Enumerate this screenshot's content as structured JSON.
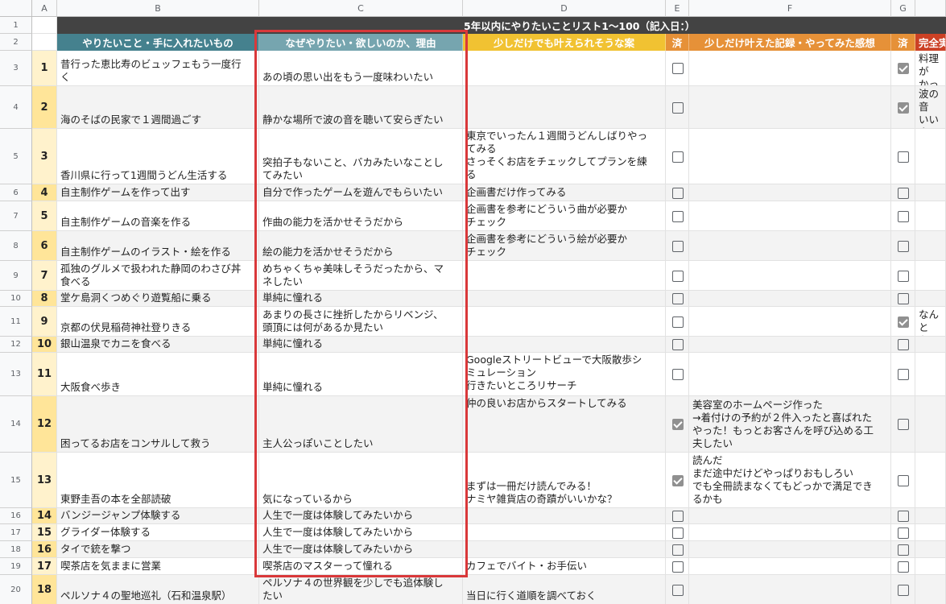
{
  "columns": [
    "A",
    "B",
    "C",
    "D",
    "E",
    "F",
    "G"
  ],
  "sheet_title": "5年以内にやりたいことリスト1〜100（記入日：）",
  "headers": {
    "b": "やりたいこと・手に入れたいもの",
    "c": "なぜやりたい・欲しいのか、理由",
    "d": "少しだけでも叶えられそうな案",
    "e": "済",
    "f": "少しだけ叶えた記録・やってみた感想",
    "g": "済",
    "h": "完全実"
  },
  "colors": {
    "header_b": "#45818e",
    "header_c": "#76a5af",
    "header_d": "#f1c232",
    "header_e": "#e69138",
    "header_f": "#e69138",
    "header_g": "#e69138",
    "header_h": "#cc4125",
    "num_bg": "#ffe599",
    "num_bg_alt": "#fff2cc",
    "title_bg": "#434343",
    "highlight": "#d9383a"
  },
  "rows": [
    {
      "rn": "1"
    },
    {
      "rn": "2"
    },
    {
      "rn": "3",
      "num": "1",
      "b": "昔行った恵比寿のビュッフェもう一度行\nく",
      "c": "あの頃の思い出をもう一度味わいたい",
      "d": "",
      "e": false,
      "f": "",
      "g": true,
      "h": "料理が\nかった"
    },
    {
      "rn": "4",
      "num": "2",
      "b": "海のそばの民家で１週間過ごす",
      "c": "静かな場所で波の音を聴いて安らぎたい",
      "d": "",
      "e": false,
      "f": "",
      "g": true,
      "h": "波の音\nいい人\nらった"
    },
    {
      "rn": "5",
      "num": "3",
      "b": "香川県に行って1週間うどん生活する",
      "c": "突拍子もないこと、バカみたいなことし\nてみたい",
      "d": "東京でいったん１週間うどんしばりやっ\nてみる\nさっそくお店をチェックしてプランを練\nる",
      "e": false,
      "f": "",
      "g": false,
      "h": ""
    },
    {
      "rn": "6",
      "num": "4",
      "b": "自主制作ゲームを作って出す",
      "c": "自分で作ったゲームを遊んでもらいたい",
      "d": "企画書だけ作ってみる",
      "e": false,
      "f": "",
      "g": false,
      "h": ""
    },
    {
      "rn": "7",
      "num": "5",
      "b": "自主制作ゲームの音楽を作る",
      "c": "作曲の能力を活かせそうだから",
      "d": "企画書を参考にどういう曲が必要か\nチェック",
      "e": false,
      "f": "",
      "g": false,
      "h": ""
    },
    {
      "rn": "8",
      "num": "6",
      "b": "自主制作ゲームのイラスト・絵を作る",
      "c": "絵の能力を活かせそうだから",
      "d": "企画書を参考にどういう絵が必要か\nチェック",
      "e": false,
      "f": "",
      "g": false,
      "h": ""
    },
    {
      "rn": "9",
      "num": "7",
      "b": "孤独のグルメで扱われた静岡のわさび丼\n食べる",
      "c": "めちゃくちゃ美味しそうだったから、マ\nネしたい",
      "d": "",
      "e": false,
      "f": "",
      "g": false,
      "h": ""
    },
    {
      "rn": "10",
      "num": "8",
      "b": "堂ケ島洞くつめぐり遊覧船に乗る",
      "c": "単純に憧れる",
      "d": "",
      "e": false,
      "f": "",
      "g": false,
      "h": ""
    },
    {
      "rn": "11",
      "num": "9",
      "b": "京都の伏見稲荷神社登りきる",
      "c": "あまりの長さに挫折したからリベンジ、\n頭頂には何があるか見たい",
      "d": "",
      "e": false,
      "f": "",
      "g": true,
      "h": "なんと\nなった"
    },
    {
      "rn": "12",
      "num": "10",
      "b": "銀山温泉でカニを食べる",
      "c": "単純に憧れる",
      "d": "",
      "e": false,
      "f": "",
      "g": false,
      "h": ""
    },
    {
      "rn": "13",
      "num": "11",
      "b": "大阪食べ歩き",
      "c": "単純に憧れる",
      "d": "Googleストリートビューで大阪散歩シ\nミュレーション\n行きたいところリサーチ",
      "e": false,
      "f": "",
      "g": false,
      "h": ""
    },
    {
      "rn": "14",
      "num": "12",
      "b": "困ってるお店をコンサルして救う",
      "c": "主人公っぽいことしたい",
      "d": "仲の良いお店からスタートしてみる",
      "e": true,
      "f": "美容室のホームページ作った\n→着付けの予約が２件入ったと喜ばれた\nやった！もっとお客さんを呼び込める工\n夫したい",
      "g": false,
      "h": ""
    },
    {
      "rn": "15",
      "num": "13",
      "b": "東野圭吾の本を全部読破",
      "c": "気になっているから",
      "d": "まずは一冊だけ読んでみる！\nナミヤ雑貨店の奇蹟がいいかな？",
      "e": true,
      "f": "読んだ\nまだ途中だけどやっぱりおもしろい\nでも全冊読まなくてもどっかで満足でき\nるかも",
      "g": false,
      "h": ""
    },
    {
      "rn": "16",
      "num": "14",
      "b": "バンジージャンプ体験する",
      "c": "人生で一度は体験してみたいから",
      "d": "",
      "e": false,
      "f": "",
      "g": false,
      "h": ""
    },
    {
      "rn": "17",
      "num": "15",
      "b": "グライダー体験する",
      "c": "人生で一度は体験してみたいから",
      "d": "",
      "e": false,
      "f": "",
      "g": false,
      "h": ""
    },
    {
      "rn": "18",
      "num": "16",
      "b": "タイで銃を撃つ",
      "c": "人生で一度は体験してみたいから",
      "d": "",
      "e": false,
      "f": "",
      "g": false,
      "h": ""
    },
    {
      "rn": "19",
      "num": "17",
      "b": "喫茶店を気ままに営業",
      "c": "喫茶店のマスターって憧れる",
      "d": "カフェでバイト・お手伝い",
      "e": false,
      "f": "",
      "g": false,
      "h": ""
    },
    {
      "rn": "20",
      "num": "18",
      "b": "ペルソナ４の聖地巡礼（石和温泉駅）",
      "c": "ペルソナ４の世界観を少しでも追体験し\nたい",
      "d": "当日に行く道順を調べておく",
      "e": false,
      "f": "",
      "g": false,
      "h": ""
    }
  ]
}
